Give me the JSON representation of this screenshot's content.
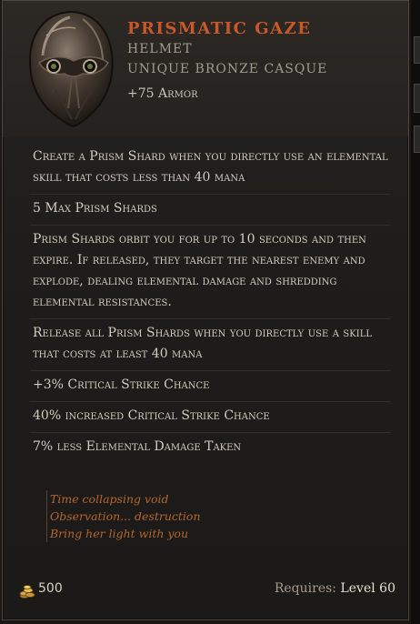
{
  "item": {
    "name": "PRISMATIC GAZE",
    "slot": "HELMET",
    "base": "UNIQUE BRONZE CASQUE",
    "armor_value": "+75",
    "armor_label": "Armor"
  },
  "affixes": [
    "Create a Prism Shard when you directly use an elemental skill that costs less than 40 mana",
    "5 Max Prism Shards",
    "Prism Shards orbit you for up to 10 seconds and then expire. If released, they target the nearest enemy and explode, dealing elemental damage and shredding elemental resistances.",
    "Release all Prism Shards when you directly use a skill that costs at least 40 mana",
    "+3% Critical Strike Chance",
    "40% increased Critical Strike Chance",
    "7% less Elemental Damage Taken"
  ],
  "lore": [
    "Time collapsing void",
    "Observation... destruction",
    "Bring her light with you"
  ],
  "footer": {
    "gold": "500",
    "requires_label": "Requires:",
    "requires_level": "Level 60"
  },
  "icons": {
    "item": "helmet-icon",
    "gold": "gold-coins-icon"
  },
  "colors": {
    "name": "#c8582a",
    "lore": "#b3652e",
    "text": "#d2cbbf"
  }
}
